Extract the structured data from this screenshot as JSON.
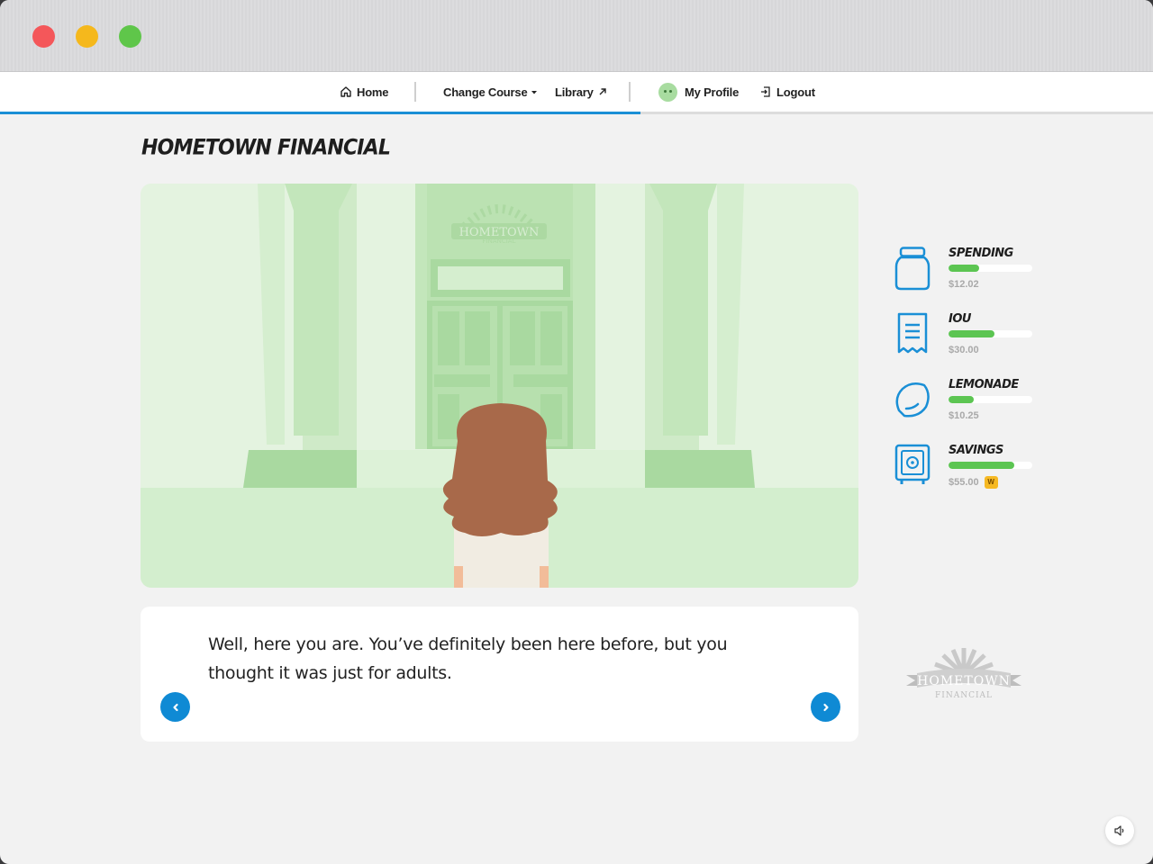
{
  "nav": {
    "home": "Home",
    "change_course": "Change Course",
    "library": "Library",
    "my_profile": "My Profile",
    "logout": "Logout"
  },
  "page": {
    "title": "HOMETOWN FINANCIAL"
  },
  "scene": {
    "sign_line1": "HOMETOWN",
    "sign_line2": "FINANCIAL"
  },
  "dialog": {
    "text": "Well, here you are. You’ve definitely been here before, but you thought it was just for adults."
  },
  "meters": [
    {
      "label": "SPENDING",
      "value": "$12.02",
      "icon": "jar-icon",
      "fill": 0.37
    },
    {
      "label": "IOU",
      "value": "$30.00",
      "icon": "receipt-icon",
      "fill": 0.55
    },
    {
      "label": "LEMONADE",
      "value": "$10.25",
      "icon": "lemon-icon",
      "fill": 0.3
    },
    {
      "label": "SAVINGS",
      "value": "$55.00",
      "icon": "safe-icon",
      "fill": 0.78,
      "badge": "W"
    }
  ],
  "brand_logo": {
    "line1": "HOMETOWN",
    "line2": "FINANCIAL"
  },
  "colors": {
    "accent_blue": "#1a8fd6",
    "meter_green": "#5cc552",
    "scene_green": "#c3e6bb",
    "hair_brown": "#a8694a",
    "badge_yellow": "#f6b923"
  }
}
